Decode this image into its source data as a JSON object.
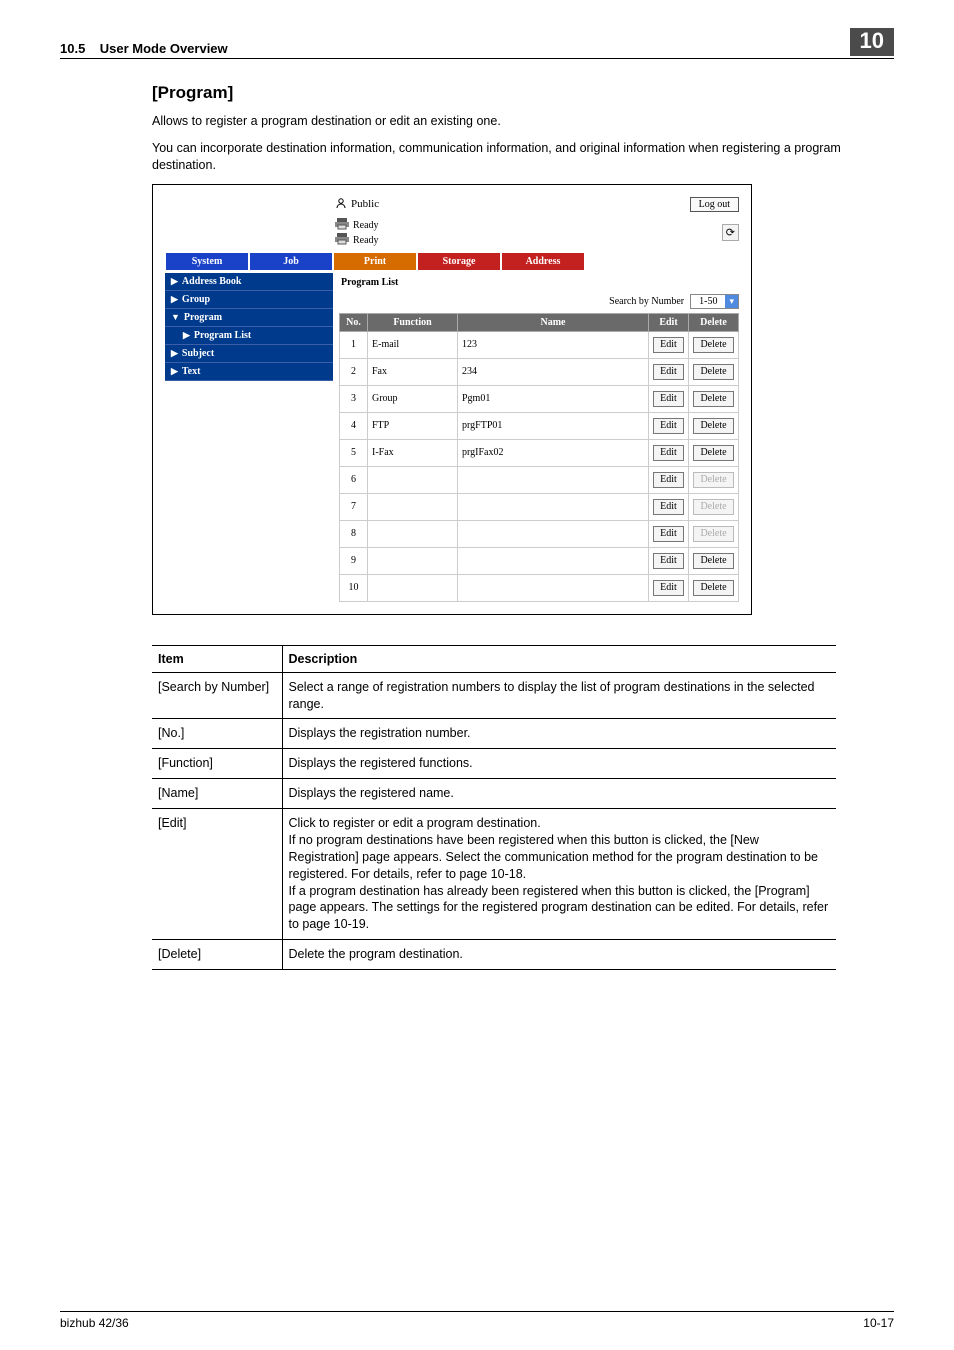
{
  "header": {
    "section": "10.5",
    "title": "User Mode Overview",
    "chapter": "10"
  },
  "page": {
    "heading": "[Program]",
    "p1": "Allows to register a program destination or edit an existing one.",
    "p2": "You can incorporate destination information, communication information, and original information when registering a program destination."
  },
  "screenshot": {
    "user_label": "Public",
    "logout": "Log out",
    "status1": "Ready",
    "status2": "Ready",
    "tabs": {
      "system": "System",
      "job": "Job",
      "print": "Print",
      "storage": "Storage",
      "address": "Address"
    },
    "sidebar": {
      "address_book": "Address Book",
      "group": "Group",
      "program": "Program",
      "program_list": "Program List",
      "subject": "Subject",
      "text": "Text"
    },
    "list_title": "Program List",
    "search_label": "Search by Number",
    "range": "1-50",
    "columns": {
      "no": "No.",
      "func": "Function",
      "name": "Name",
      "edit": "Edit",
      "delete": "Delete"
    },
    "rows": [
      {
        "no": "1",
        "func": "E-mail",
        "name": "123",
        "edit": "Edit",
        "del": "Delete",
        "del_dis": false
      },
      {
        "no": "2",
        "func": "Fax",
        "name": "234",
        "edit": "Edit",
        "del": "Delete",
        "del_dis": false
      },
      {
        "no": "3",
        "func": "Group",
        "name": "Pgm01",
        "edit": "Edit",
        "del": "Delete",
        "del_dis": false
      },
      {
        "no": "4",
        "func": "FTP",
        "name": "prgFTP01",
        "edit": "Edit",
        "del": "Delete",
        "del_dis": false
      },
      {
        "no": "5",
        "func": "I-Fax",
        "name": "prgIFax02",
        "edit": "Edit",
        "del": "Delete",
        "del_dis": false
      },
      {
        "no": "6",
        "func": "",
        "name": "",
        "edit": "Edit",
        "del": "Delete",
        "del_dis": true
      },
      {
        "no": "7",
        "func": "",
        "name": "",
        "edit": "Edit",
        "del": "Delete",
        "del_dis": true
      },
      {
        "no": "8",
        "func": "",
        "name": "",
        "edit": "Edit",
        "del": "Delete",
        "del_dis": true
      },
      {
        "no": "9",
        "func": "",
        "name": "",
        "edit": "Edit",
        "del": "Delete",
        "del_dis": false
      },
      {
        "no": "10",
        "func": "",
        "name": "",
        "edit": "Edit",
        "del": "Delete",
        "del_dis": false
      }
    ]
  },
  "desc_table": {
    "h_item": "Item",
    "h_desc": "Description",
    "rows": [
      {
        "item": "[Search by Number]",
        "desc": "Select a range of registration numbers to display the list of program destinations in the selected range."
      },
      {
        "item": "[No.]",
        "desc": "Displays the registration number."
      },
      {
        "item": "[Function]",
        "desc": "Displays the registered functions."
      },
      {
        "item": "[Name]",
        "desc": "Displays the registered name."
      },
      {
        "item": "[Edit]",
        "desc": "Click to register or edit a program destination.\nIf no program destinations have been registered when this button is clicked, the [New Registration] page appears. Select the communication method for the program destination to be registered. For details, refer to page 10-18.\nIf a program destination has already been registered when this button is clicked, the [Program] page appears. The settings for the registered program destination can be edited. For details, refer to page 10-19."
      },
      {
        "item": "[Delete]",
        "desc": "Delete the program destination."
      }
    ]
  },
  "footer": {
    "left": "bizhub 42/36",
    "right": "10-17"
  }
}
